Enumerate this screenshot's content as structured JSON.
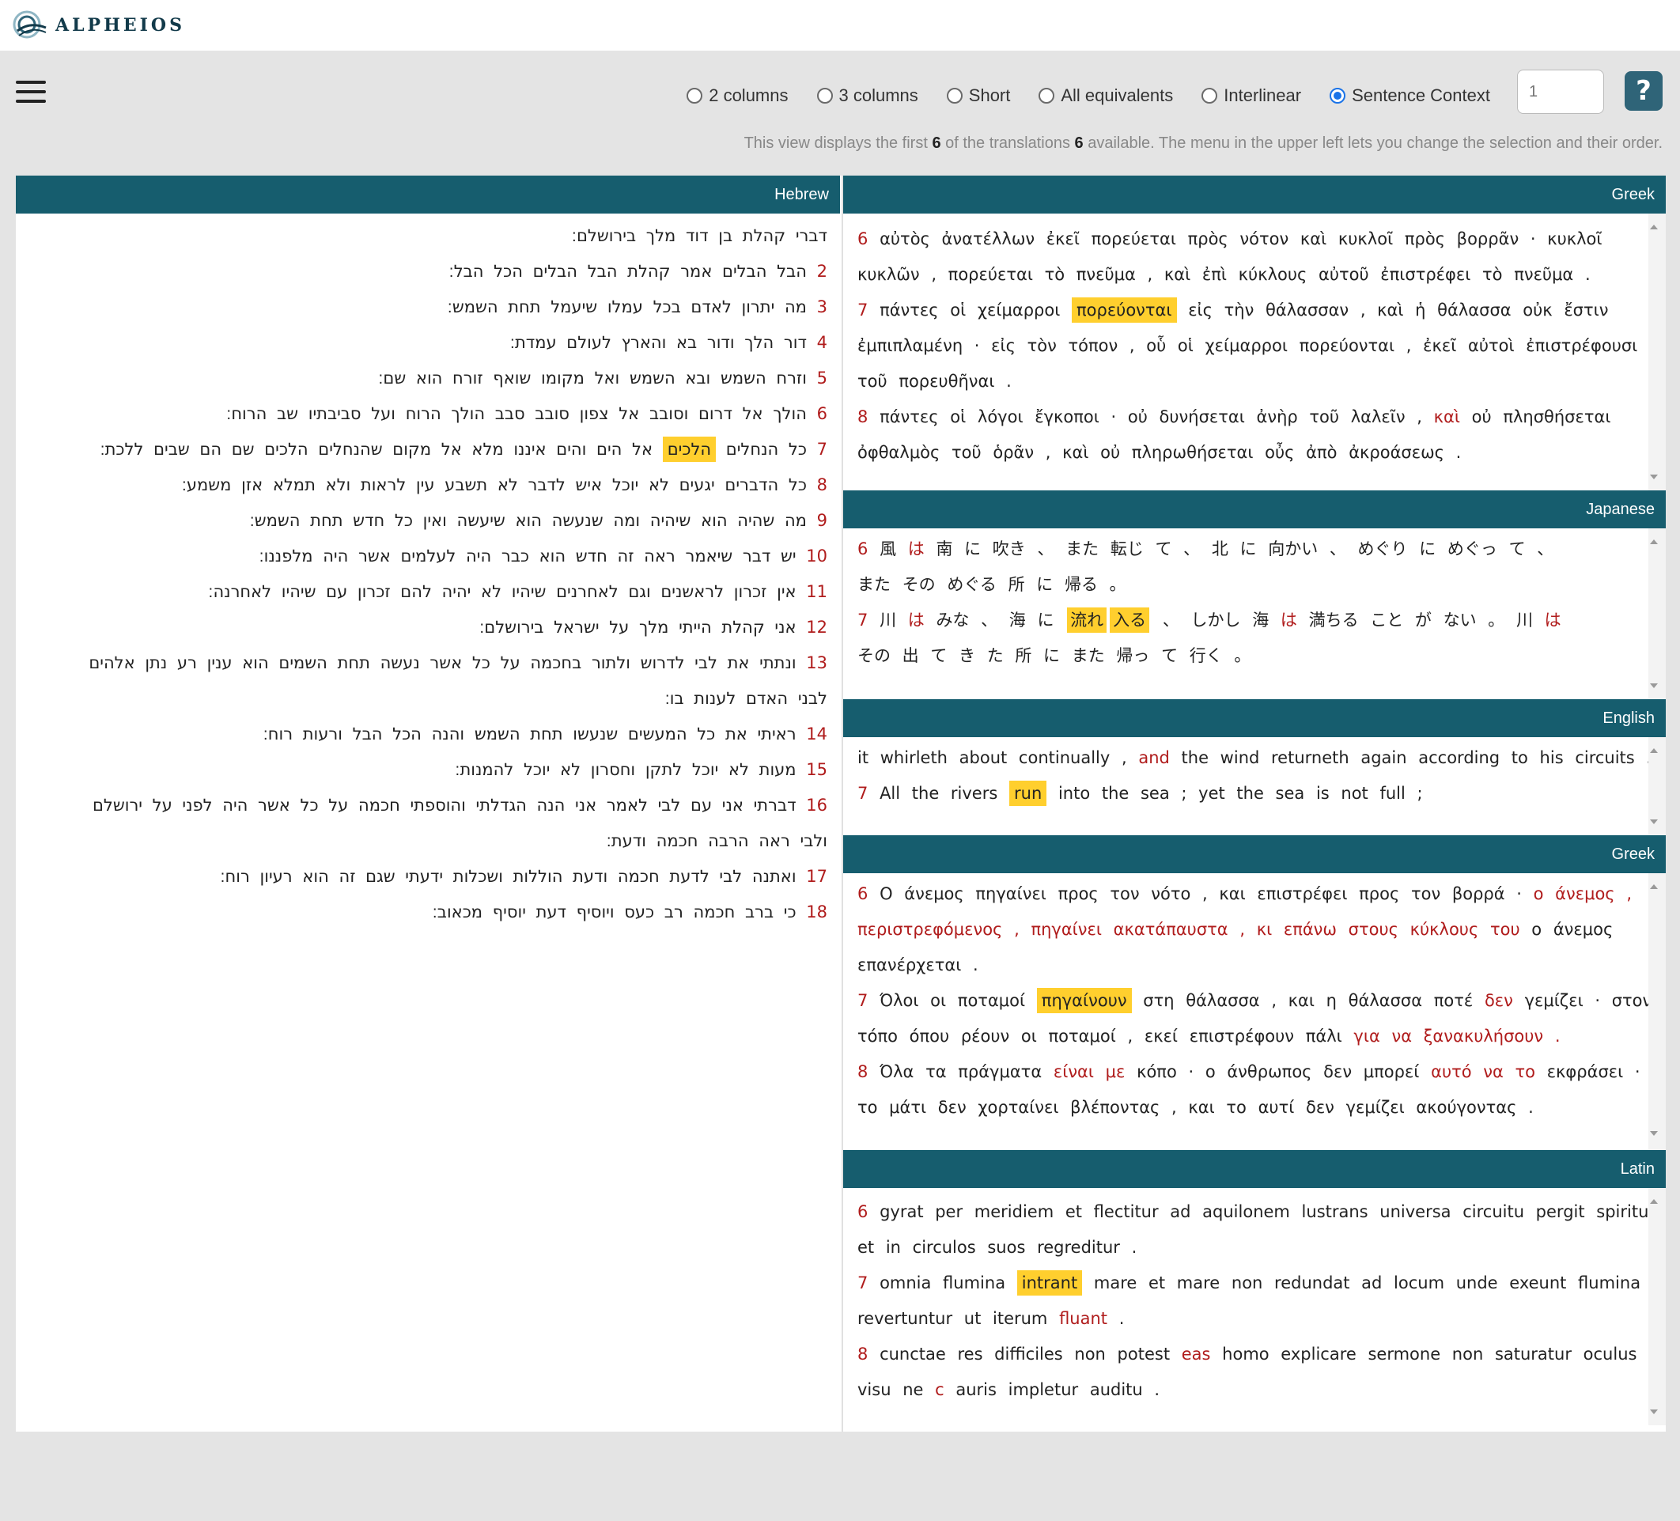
{
  "app": {
    "logo_text": "ALPHEIOS"
  },
  "controls": {
    "options": [
      {
        "label": "2 columns",
        "selected": false
      },
      {
        "label": "3 columns",
        "selected": false
      },
      {
        "label": "Short",
        "selected": false
      },
      {
        "label": "All equivalents",
        "selected": false
      },
      {
        "label": "Interlinear",
        "selected": false
      },
      {
        "label": "Sentence Context",
        "selected": true
      }
    ],
    "sentence_count_placeholder": "1",
    "help_label": "?",
    "info": {
      "pre": "This view displays the first ",
      "shown": "6",
      "mid": " of the translations ",
      "available": "6",
      "post": " available. The menu in the upper left lets you change the selection and their order."
    }
  },
  "hebrew": {
    "title": "Hebrew",
    "lines": [
      {
        "num": "",
        "text": "דברי קהלת בן דוד מלך בירושלם׃"
      },
      {
        "num": "2",
        "text": "הבל הבלים אמר קהלת הבל הבלים הכל הבל׃"
      },
      {
        "num": "3",
        "text": "מה יתרון לאדם בכל עמלו שיעמל תחת השמש׃"
      },
      {
        "num": "4",
        "text": "דור הלך ודור בא והארץ לעולם עמדת׃"
      },
      {
        "num": "5",
        "text": "וזרח השמש ובא השמש ואל מקומו שואף זורח הוא שם׃"
      },
      {
        "num": "6",
        "text": "הולך אל דרום וסובב אל צפון סובב סבב הולך הרוח ועל סביבתיו שב הרוח׃"
      },
      {
        "num": "7",
        "pre": "כל הנחלים",
        "hl": "הלכים",
        "post": "אל הים והים איננו מלא אל מקום שהנחלים הלכים שם הם שבים ללכת׃"
      },
      {
        "num": "8",
        "text": "כל הדברים יגעים לא יוכל איש לדבר לא תשבע עין לראות ולא תמלא אזן משמע׃"
      },
      {
        "num": "9",
        "text": "מה שהיה הוא שיהיה ומה שנעשה הוא שיעשה ואין כל חדש תחת השמש׃"
      },
      {
        "num": "10",
        "text": "יש דבר שיאמר ראה זה חדש הוא כבר היה לעלמים אשר היה מלפננו׃"
      },
      {
        "num": "11",
        "text": "אין זכרון לראשנים וגם לאחרנים שיהיו לא יהיה להם זכרון עם שיהיו לאחרנה׃"
      },
      {
        "num": "12",
        "text": "אני קהלת הייתי מלך על ישראל בירושלם׃"
      },
      {
        "num": "13",
        "text": "ונתתי את לבי לדרוש ולתור בחכמה על כל אשר נעשה תחת השמים הוא ענין רע נתן אלהים"
      },
      {
        "num": "",
        "text": "לבני האדם לענות בו׃"
      },
      {
        "num": "14",
        "text": "ראיתי את כל המעשים שנעשו תחת השמש והנה הכל הבל ורעות רוח׃"
      },
      {
        "num": "15",
        "text": "מעות לא יוכל לתקן וחסרון לא יוכל להמנות׃"
      },
      {
        "num": "16",
        "text": "דברתי אני עם לבי לאמר אני הנה הגדלתי והוספתי חכמה על כל אשר היה לפני על ירושלם"
      },
      {
        "num": "",
        "text": "ולבי ראה הרבה חכמה ודעת׃"
      },
      {
        "num": "17",
        "text": "ואתנה לבי לדעת חכמה ודעת הוללות ושכלות ידעתי שגם זה הוא רעיון רוח׃"
      },
      {
        "num": "18",
        "text": "כי ברב חכמה רב כעס ויוסיף דעת יוסיף מכאוב׃"
      }
    ]
  },
  "panels": {
    "greek1": {
      "title": "Greek",
      "v6_num": "6",
      "v6a": "αὐτὸς ἀνατέλλων ἐκεῖ πορεύεται πρὸς νότον καὶ κυκλοῖ πρὸς βορρᾶν · κυκλοῖ",
      "v6b": "κυκλῶν , πορεύεται τὸ πνεῦμα , καὶ ἐπὶ κύκλους αὐτοῦ ἐπιστρέφει τὸ πνεῦμα .",
      "v7_num": "7",
      "v7_pre": "πάντες οἱ χείμαρροι",
      "v7_hl": "πορεύονται",
      "v7_post": "εἰς τὴν θάλασσαν , καὶ ἡ θάλασσα οὐκ ἔστιν",
      "v7b": "ἐμπιπλαμένη · εἰς τὸν τόπον , οὗ οἱ χείμαρροι πορεύονται , ἐκεῖ αὐτοὶ ἐπιστρέφουσι",
      "v7c": "τοῦ πορευθῆναι .",
      "v8_num": "8",
      "v8_pre": "πάντες οἱ λόγοι ἔγκοποι · οὐ δυνήσεται ἀνὴρ τοῦ λαλεῖν ,",
      "v8_red": "καὶ",
      "v8_post": "οὐ πλησθήσεται",
      "v8b": "ὀφθαλμὸς τοῦ ὁρᾶν , καὶ οὐ πληρωθήσεται οὖς ἀπὸ ἀκροάσεως ."
    },
    "japanese": {
      "title": "Japanese",
      "v6_num": "6",
      "v6_a": "風",
      "v6_b": "は",
      "v6_c": "南 に 吹き 、 また 転じ て 、 北 に 向かい 、 めぐり に めぐっ て 、",
      "v6_d": "また その めぐる 所 に 帰る 。",
      "v7_num": "7",
      "v7_a": "川",
      "v7_b": "は",
      "v7_c": "みな 、 海 に",
      "v7_hl1": "流れ",
      "v7_hl2": "入る",
      "v7_d": "、 しかし 海",
      "v7_e": "は",
      "v7_f": "満ちる こと が ない 。 川",
      "v7_g": "は",
      "v7_h": "その 出 て き た 所 に また 帰っ て 行く 。"
    },
    "english": {
      "title": "English",
      "line1_pre": "it whirleth about continually ,",
      "line1_red": "and",
      "line1_post": "the wind returneth again according to his circuits .",
      "v7_num": "7",
      "v7_pre": "All the rivers",
      "v7_hl": "run",
      "v7_post": "into the sea ; yet the sea is not full ;"
    },
    "greek2": {
      "title": "Greek",
      "v6_num": "6",
      "v6_a": "Ο άνεμος πηγαίνει προς τον νότο , και επιστρέφει προς τον βορρά ·",
      "v6_red1": "ο άνεμος",
      "v6_b": ",",
      "v6_red2": "περιστρεφόμενος",
      "v6_c": ",",
      "v6_red3": "πηγαίνει ακατάπαυστα",
      "v6_d": ",",
      "v6_red4": "κι επάνω στους κύκλους του",
      "v6_e": "ο άνεμος",
      "v6_f": "επανέρχεται .",
      "v7_num": "7",
      "v7_pre": "Όλοι οι ποταμοί",
      "v7_hl": "πηγαίνουν",
      "v7_mid": "στη θάλασσα , και η θάλασσα ποτέ",
      "v7_red1": "δεν",
      "v7_post": "γεμίζει · στον",
      "v7b_pre": "τόπο όπου ρέουν οι ποταμοί , εκεί επιστρέφουν πάλι",
      "v7b_red": "για να ξανακυλήσουν",
      "v7b_post": ".",
      "v8_num": "8",
      "v8_pre": "Όλα τα πράγματα",
      "v8_red1": "είναι με",
      "v8_mid": "κόπο · ο άνθρωπος δεν μπορεί",
      "v8_red2": "αυτό να το",
      "v8_post": "εκφράσει ·",
      "v8b": "το μάτι δεν χορταίνει βλέποντας , και το αυτί δεν γεμίζει ακούγοντας ."
    },
    "latin": {
      "title": "Latin",
      "v6_num": "6",
      "v6a": "gyrat per meridiem et flectitur ad aquilonem lustrans universa circuitu pergit spiritus",
      "v6b": "et in circulos suos regreditur .",
      "v7_num": "7",
      "v7_pre": "omnia flumina",
      "v7_hl": "intrant",
      "v7_post": "mare et mare non redundat ad locum unde exeunt flumina",
      "v7b_pre": "revertuntur ut iterum",
      "v7b_red": "fluant",
      "v7b_post": ".",
      "v8_num": "8",
      "v8_pre": "cunctae res difficiles non potest",
      "v8_red": "eas",
      "v8_post": "homo explicare sermone non saturatur oculus",
      "v8b_pre": "visu ne",
      "v8b_red": "c",
      "v8b_post": "auris impletur auditu ."
    }
  }
}
